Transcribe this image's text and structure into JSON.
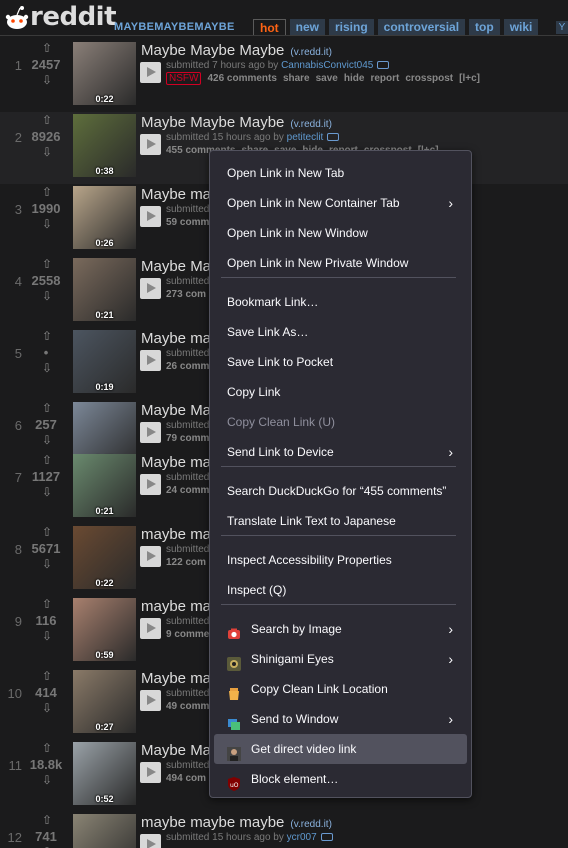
{
  "header": {
    "wordmark": "reddit",
    "subreddit": "MAYBEMAYBEMAYBE",
    "tabs": [
      {
        "label": "hot",
        "selected": true
      },
      {
        "label": "new",
        "selected": false
      },
      {
        "label": "rising",
        "selected": false
      },
      {
        "label": "controversial",
        "selected": false
      },
      {
        "label": "top",
        "selected": false
      },
      {
        "label": "wiki",
        "selected": false
      }
    ],
    "filter_icon": "Y"
  },
  "posts": [
    {
      "rank": "1",
      "score": "2457",
      "duration": "0:22",
      "title": "Maybe Maybe Maybe",
      "domain": "(v.redd.it)",
      "submitted": "submitted 7 hours ago by",
      "author": "CannabisConvict045",
      "nsfw": "NSFW",
      "comments": "426 comments",
      "thumb_color": "#8a7f78"
    },
    {
      "rank": "2",
      "score": "8926",
      "duration": "0:38",
      "title": "Maybe Maybe Maybe",
      "domain": "(v.redd.it)",
      "submitted": "submitted 15 hours ago by",
      "author": "petiteclit",
      "comments": "455 comments",
      "thumb_color": "#5e6e3c"
    },
    {
      "rank": "3",
      "score": "1990",
      "duration": "0:26",
      "title": "Maybe ma",
      "submitted": "submitted",
      "comments": "59 comm",
      "thumb_color": "#b8a58a"
    },
    {
      "rank": "4",
      "score": "2558",
      "duration": "0:21",
      "title": "Maybe Ma",
      "submitted": "submitted",
      "comments": "273 com",
      "thumb_color": "#7a6a5c"
    },
    {
      "rank": "5",
      "score": "•",
      "duration": "0:19",
      "title": "Maybe ma",
      "submitted": "submitted",
      "comments": "26 comm",
      "thumb_color": "#4c5560"
    },
    {
      "rank": "6",
      "score": "257",
      "duration": "0:40",
      "title": "Maybe Ma",
      "submitted": "submitted",
      "comments": "79 comm",
      "thumb_color": "#7c8898"
    },
    {
      "rank": "7",
      "score": "1127",
      "duration": "0:21",
      "title": "Maybe ma",
      "submitted": "submitted",
      "comments": "24 comm",
      "thumb_color": "#6a8a6e"
    },
    {
      "rank": "8",
      "score": "5671",
      "duration": "0:22",
      "title": "maybe ma",
      "submitted": "submitted",
      "comments": "122 com",
      "thumb_color": "#6a4a32"
    },
    {
      "rank": "9",
      "score": "116",
      "duration": "0:59",
      "title": "maybe ma",
      "submitted": "submitted",
      "comments": "9 comme",
      "thumb_color": "#a8806e"
    },
    {
      "rank": "10",
      "score": "414",
      "duration": "0:27",
      "title": "Maybe ma",
      "submitted": "submitted",
      "comments": "49 comm",
      "thumb_color": "#8a7a68"
    },
    {
      "rank": "11",
      "score": "18.8k",
      "duration": "0:52",
      "title": "Maybe Ma",
      "submitted": "submitted",
      "comments": "494 com",
      "thumb_color": "#9aa2a8"
    },
    {
      "rank": "12",
      "score": "741",
      "duration": "",
      "title": "maybe maybe maybe",
      "domain": "(v.redd.it)",
      "submitted": "submitted 15 hours ago by",
      "author": "ycr007",
      "comments": "",
      "thumb_color": "#8a8474"
    }
  ],
  "post_actions": [
    "share",
    "save",
    "hide",
    "report",
    "crosspost",
    "[l+c]"
  ],
  "context_menu": {
    "items": [
      {
        "label": "Open Link in New Tab",
        "disabled": false,
        "submenu": false
      },
      {
        "label": "Open Link in New Container Tab",
        "disabled": false,
        "submenu": true
      },
      {
        "label": "Open Link in New Window",
        "disabled": false,
        "submenu": false
      },
      {
        "label": "Open Link in New Private Window",
        "disabled": false,
        "submenu": false
      },
      {
        "label": "Bookmark Link…",
        "disabled": false,
        "submenu": false
      },
      {
        "label": "Save Link As…",
        "disabled": false,
        "submenu": false
      },
      {
        "label": "Save Link to Pocket",
        "disabled": false,
        "submenu": false
      },
      {
        "label": "Copy Link",
        "disabled": false,
        "submenu": false
      },
      {
        "label": "Copy Clean Link (U)",
        "disabled": true,
        "submenu": false
      },
      {
        "label": "Send Link to Device",
        "disabled": false,
        "submenu": true
      },
      {
        "label": "Search DuckDuckGo for “455 comments”",
        "disabled": false,
        "submenu": false
      },
      {
        "label": "Translate Link Text to Japanese",
        "disabled": false,
        "submenu": false
      },
      {
        "label": "Inspect Accessibility Properties",
        "disabled": false,
        "submenu": false
      },
      {
        "label": "Inspect (Q)",
        "disabled": false,
        "submenu": false
      },
      {
        "label": "Search by Image",
        "disabled": false,
        "submenu": true,
        "icon": "camera-icon"
      },
      {
        "label": "Shinigami Eyes",
        "disabled": false,
        "submenu": true,
        "icon": "eye-icon"
      },
      {
        "label": "Copy Clean Link Location",
        "disabled": false,
        "submenu": false,
        "icon": "broom-icon"
      },
      {
        "label": "Send to Window",
        "disabled": false,
        "submenu": true,
        "icon": "windows-icon"
      },
      {
        "label": "Get direct video link",
        "disabled": false,
        "submenu": false,
        "icon": "avatar-icon",
        "hovered": true
      },
      {
        "label": "Block element…",
        "disabled": false,
        "submenu": false,
        "icon": "ublock-icon"
      }
    ]
  }
}
